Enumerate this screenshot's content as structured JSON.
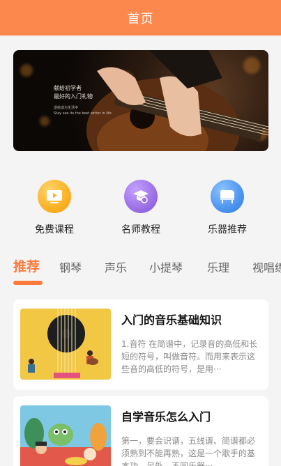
{
  "header": {
    "title": "首页"
  },
  "banner": {
    "line1": "献给初学者",
    "line2": "最好的入门礼物",
    "line3": "送给成为生活中",
    "line4": "Stay see its the best writer in life"
  },
  "categories": [
    {
      "label": "免费课程",
      "icon": "video-icon",
      "color": "#fbb125"
    },
    {
      "label": "名师教程",
      "icon": "teacher-icon",
      "color": "#9c70e6"
    },
    {
      "label": "乐器推荐",
      "icon": "piano-icon",
      "color": "#4c95ef"
    }
  ],
  "tabs": [
    "推荐",
    "钢琴",
    "声乐",
    "小提琴",
    "乐理",
    "视唱练耳"
  ],
  "active_tab": "推荐",
  "articles": [
    {
      "title": "入门的音乐基础知识",
      "desc": "1.音符 在简谱中，记录音的高低和长短的符号，叫做音符。而用来表示这些音的高低的符号，是用···"
    },
    {
      "title": "自学音乐怎么入门",
      "desc": "第一，要会识谱，五线谱、简谱都必须熟到不能再熟，这是一个歌手的基本功，另外，不同乐器···"
    }
  ],
  "colors": {
    "accent": "#fd884d",
    "tab_active": "#fd7a3c"
  }
}
